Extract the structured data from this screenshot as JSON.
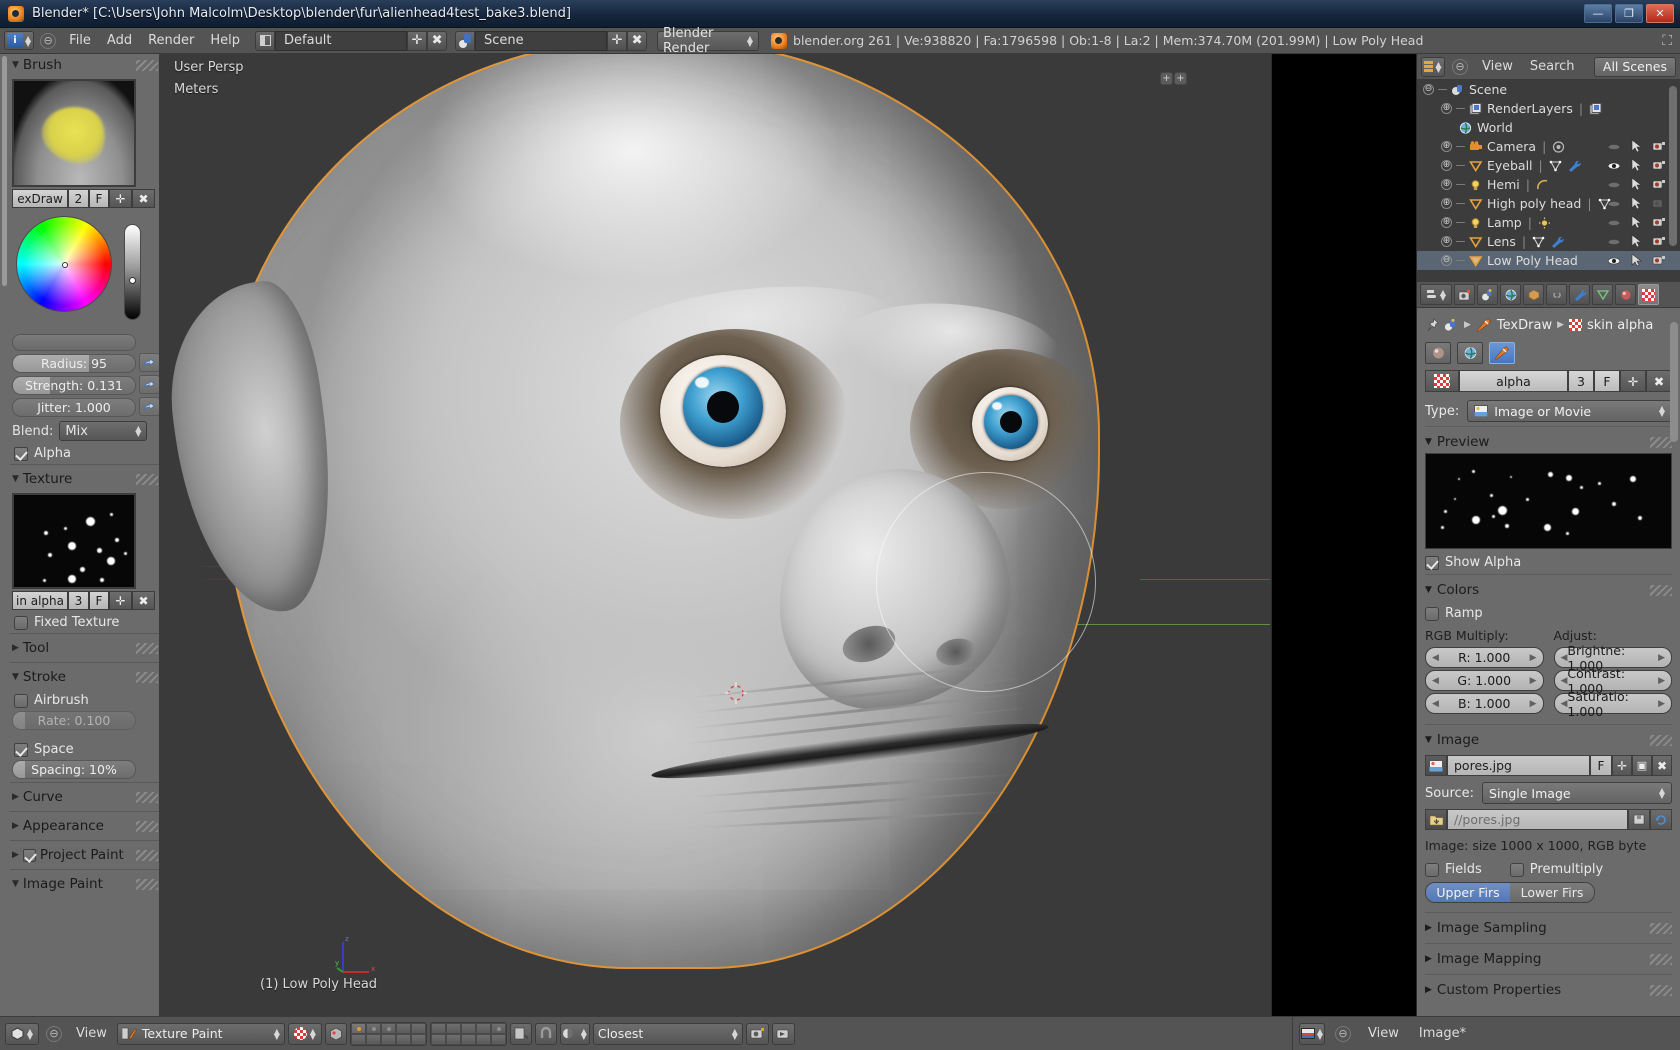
{
  "window": {
    "title": "Blender* [C:\\Users\\John Malcolm\\Desktop\\blender\\fur\\alienhead4test_bake3.blend]",
    "minimize": "—",
    "maximize": "❐",
    "close": "✕"
  },
  "infobar": {
    "collapse": "⊖",
    "menus": [
      "File",
      "Add",
      "Render",
      "Help"
    ],
    "screen_layout": "Default",
    "scene_name": "Scene",
    "engine": "Blender Render",
    "add_icon": "✛",
    "del_icon": "✖",
    "stats": "blender.org 261 | Ve:938820 | Fa:1796598 | Ob:1-8 | La:2 | Mem:374.70M (201.99M) | Low Poly Head",
    "fullscreen_icon": "⛶"
  },
  "toolshelf": {
    "brush": {
      "title": "Brush",
      "name": "exDraw",
      "users": "2",
      "fake_user": "F",
      "add": "✛",
      "unlink": "✖",
      "radius": "Radius: 95",
      "radius_pct": 62,
      "strength": "Strength: 0.131",
      "strength_pct": 30,
      "jitter": "Jitter: 1.000",
      "jitter_pct": 0,
      "blend_label": "Blend:",
      "blend_value": "Mix",
      "alpha_label": "Alpha"
    },
    "texture": {
      "title": "Texture",
      "name": "in alpha",
      "users": "3",
      "fake_user": "F",
      "add": "✛",
      "unlink": "✖",
      "fixed_texture": "Fixed Texture"
    },
    "tool": {
      "title": "Tool"
    },
    "stroke": {
      "title": "Stroke",
      "airbrush": "Airbrush",
      "rate": "Rate: 0.100",
      "space": "Space",
      "spacing": "Spacing: 10%",
      "spacing_pct": 10
    },
    "curve": {
      "title": "Curve"
    },
    "appearance": {
      "title": "Appearance"
    },
    "project_paint": {
      "title": "Project Paint"
    },
    "image_paint": {
      "title": "Image Paint"
    }
  },
  "viewport": {
    "perspective": "User Persp",
    "units": "Meters",
    "active_object": "(1) Low Poly Head",
    "axis_x": "x",
    "axis_y": "y",
    "axis_z": "z"
  },
  "viewport_header": {
    "collapse": "⊖",
    "view_menu": "View",
    "mode": "Texture Paint",
    "texture_mode": "Closest"
  },
  "outliner": {
    "collapse": "⊖",
    "view_menu": "View",
    "search_menu": "Search",
    "display_mode": "All Scenes",
    "rows": [
      {
        "name": "Scene",
        "indent": 0,
        "expander": "⊖",
        "icon": "scene-icon",
        "selected": false,
        "extras": []
      },
      {
        "name": "RenderLayers",
        "indent": 1,
        "expander": "⊕",
        "icon": "renderlayer-icon",
        "selected": false,
        "extras": [
          "renderlayer"
        ]
      },
      {
        "name": "World",
        "indent": 1,
        "expander": "",
        "icon": "world-icon",
        "selected": false,
        "extras": []
      },
      {
        "name": "Camera",
        "indent": 1,
        "expander": "⊕",
        "icon": "camera-icon",
        "selected": false,
        "extras": [
          "camera-data"
        ]
      },
      {
        "name": "Eyeball",
        "indent": 1,
        "expander": "⊕",
        "icon": "mesh-icon",
        "selected": false,
        "extras": [
          "mesh-data",
          "wrench"
        ]
      },
      {
        "name": "Hemi",
        "indent": 1,
        "expander": "⊕",
        "icon": "lamp-icon",
        "selected": false,
        "extras": [
          "hemi-data"
        ]
      },
      {
        "name": "High poly head",
        "indent": 1,
        "expander": "⊕",
        "icon": "mesh-icon",
        "selected": false,
        "extras": [
          "mesh-data"
        ]
      },
      {
        "name": "Lamp",
        "indent": 1,
        "expander": "⊕",
        "icon": "lamp-icon",
        "selected": false,
        "extras": [
          "lamp-data"
        ]
      },
      {
        "name": "Lens",
        "indent": 1,
        "expander": "⊕",
        "icon": "mesh-icon",
        "selected": false,
        "extras": [
          "mesh-data",
          "wrench"
        ]
      },
      {
        "name": "Low Poly Head",
        "indent": 1,
        "expander": "⊖",
        "icon": "mesh-icon",
        "selected": true,
        "extras": []
      }
    ]
  },
  "properties": {
    "breadcrumb_brush": "TexDraw",
    "breadcrumb_texture": "skin alpha",
    "datablock_name": "alpha",
    "datablock_users": "3",
    "datablock_fake": "F",
    "datablock_add": "✛",
    "datablock_unlink": "✖",
    "type_label": "Type:",
    "type_value": "Image or Movie",
    "preview": {
      "title": "Preview",
      "show_alpha": "Show Alpha"
    },
    "colors": {
      "title": "Colors",
      "ramp": "Ramp",
      "rgb_multiply_label": "RGB Multiply:",
      "adjust_label": "Adjust:",
      "r": "R: 1.000",
      "g": "G: 1.000",
      "b": "B: 1.000",
      "brightness": "Brightne: 1.000",
      "contrast": "Contrast: 1.000",
      "saturation": "Saturatio: 1.000"
    },
    "image": {
      "title": "Image",
      "name": "pores.jpg",
      "fake_user": "F",
      "add": "✛",
      "pack": "▣",
      "unlink": "✖",
      "source_label": "Source:",
      "source_value": "Single Image",
      "filepath": "//pores.jpg",
      "info": "Image: size 1000 x 1000, RGB byte",
      "fields": "Fields",
      "premultiply": "Premultiply",
      "upper_first": "Upper Firs",
      "lower_first": "Lower Firs"
    },
    "image_sampling": {
      "title": "Image Sampling"
    },
    "image_mapping": {
      "title": "Image Mapping"
    },
    "custom_properties": {
      "title": "Custom Properties"
    }
  },
  "image_editor_header": {
    "collapse": "⊖",
    "view_menu": "View",
    "image_menu": "Image*"
  },
  "colors": {
    "header_bg": "#545454",
    "panel_bg": "#6b6b6b",
    "outliner_bg": "#3c3c3c",
    "viewport_bg": "#3a3a3a",
    "accent_orange": "#e8903c",
    "accent_blue": "#5577b4",
    "selection": "#5a6673"
  }
}
